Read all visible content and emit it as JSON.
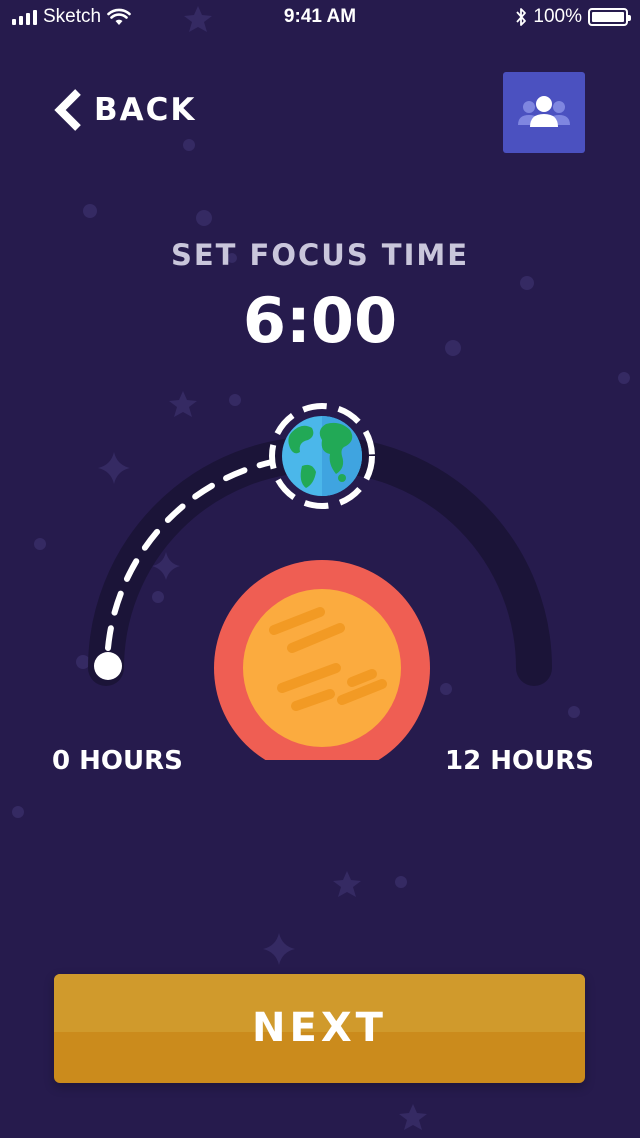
{
  "status_bar": {
    "carrier": "Sketch",
    "time": "9:41 AM",
    "battery": "100%",
    "icons": [
      "signal-bars-icon",
      "wifi-icon",
      "bluetooth-icon",
      "battery-icon"
    ]
  },
  "header": {
    "back_label": "BACK",
    "back_icon": "chevron-left-icon",
    "friends_icon": "group-users-icon"
  },
  "focus": {
    "title": "SET FOCUS TIME",
    "time_value": "6:00",
    "slider_min_label": "0 HOURS",
    "slider_max_label": "12 HOURS",
    "slider_fraction": 0.5
  },
  "footer": {
    "next_label": "NEXT"
  },
  "colors": {
    "background": "#261b4d",
    "track": "#1b1438",
    "friends_button": "#4b51c0",
    "next_button": "#cb8b1c",
    "sun_outer": "#ef5e53",
    "sun_inner": "#fbab3f"
  }
}
